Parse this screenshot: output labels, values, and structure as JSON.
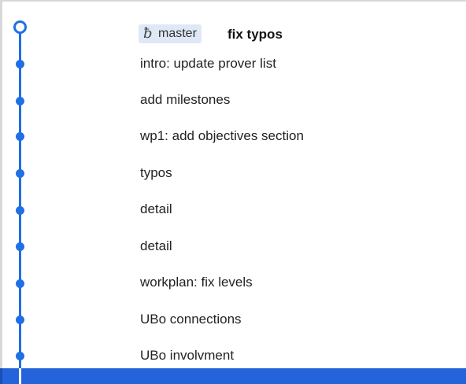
{
  "head": {
    "branch": "master",
    "branch_icon": "git-branch-icon",
    "message": "fix typos"
  },
  "commits": [
    {
      "message": "intro: update prover list"
    },
    {
      "message": "add milestones"
    },
    {
      "message": "wp1: add objectives section"
    },
    {
      "message": "typos"
    },
    {
      "message": "detail"
    },
    {
      "message": "detail"
    },
    {
      "message": "workplan: fix levels"
    },
    {
      "message": "UBo connections"
    },
    {
      "message": "UBo involvment"
    }
  ],
  "colors": {
    "graph": "#1f6fe6",
    "branch_pill": "#dfe8f7",
    "selection": "#2463d9"
  }
}
